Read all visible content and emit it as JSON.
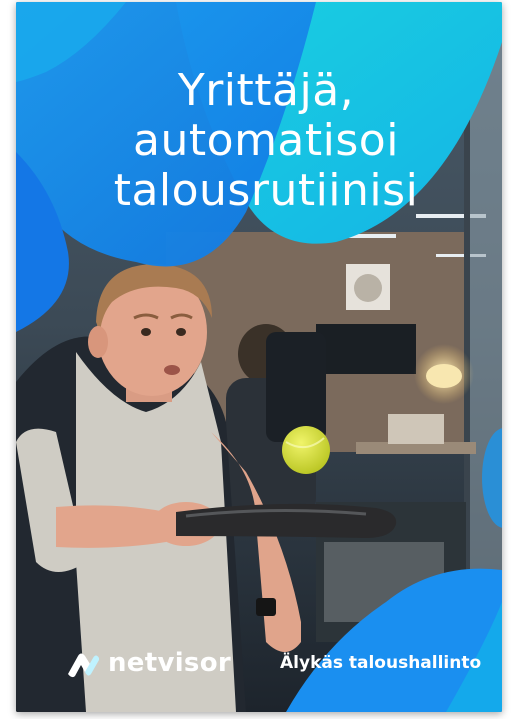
{
  "ad": {
    "headline": [
      "Yrittäjä,",
      "automatisoi",
      "talousrutiinisi"
    ],
    "brand": "netvisor",
    "tagline": "Älykäs taloushallinto",
    "brand_icon": "netvisor-logo-icon",
    "colors": {
      "blue": "#1477e6",
      "cyan": "#15c8de",
      "white": "#ffffff"
    }
  }
}
